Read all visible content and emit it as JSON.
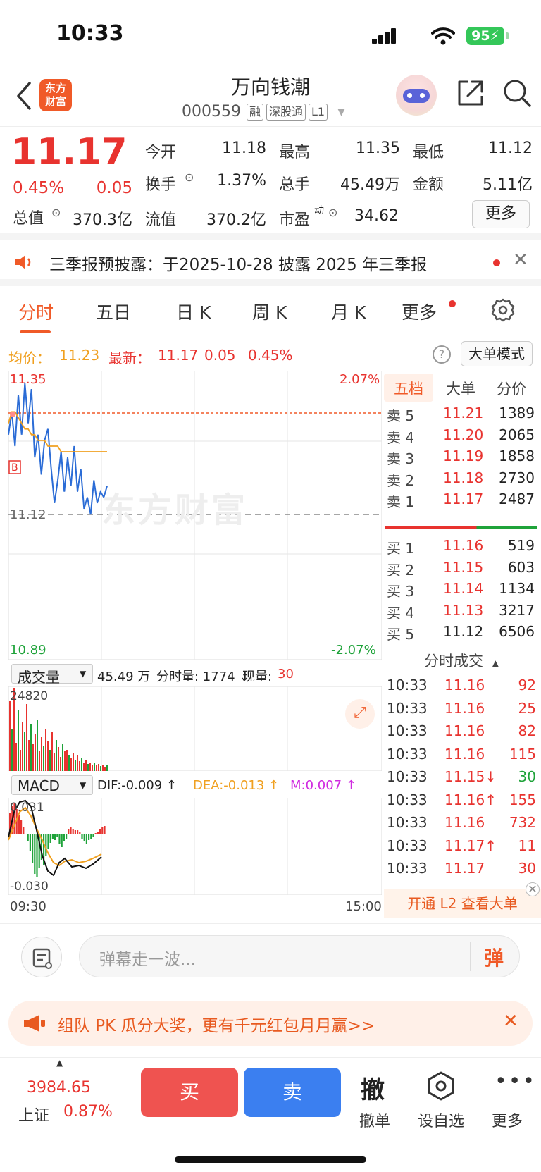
{
  "status_bar": {
    "time": "10:33",
    "battery": "95"
  },
  "header": {
    "logo_line1": "东方",
    "logo_line2": "财富",
    "stock_name": "万向钱潮",
    "stock_code": "000559",
    "tags": [
      "融",
      "深股通",
      "L1"
    ]
  },
  "quote": {
    "last_price": "11.17",
    "change_pct": "0.45%",
    "change_amt": "0.05",
    "open_label": "今开",
    "open": "11.18",
    "high_label": "最高",
    "high": "11.35",
    "low_label": "最低",
    "low": "11.12",
    "turnover_label": "换手",
    "turnover": "1.37%",
    "volume_label": "总手",
    "volume": "45.49万",
    "amount_label": "金额",
    "amount": "5.11亿",
    "mktcap_label": "总值",
    "mktcap": "370.3亿",
    "float_label": "流值",
    "float_cap": "370.2亿",
    "pe_label": "市盈",
    "pe_sup": "动",
    "pe": "34.62",
    "more_label": "更多"
  },
  "notice": {
    "text": "三季报预披露：于2025-10-28 披露 2025 年三季报"
  },
  "tabs": [
    "分时",
    "五日",
    "日 K",
    "周 K",
    "月 K",
    "更多"
  ],
  "price_info": {
    "avg_label": "均价：",
    "avg": "11.23",
    "latest_label": "最新：",
    "latest": "11.17",
    "chg": "0.05",
    "pct": "0.45%",
    "big_order_mode": "大单模式"
  },
  "chart": {
    "top_price": "11.35",
    "mid_price": "11.12",
    "bottom_price": "10.89",
    "top_pct": "2.07%",
    "bottom_pct": "-2.07%",
    "watermark": "东方财富",
    "volume_selector": "成交量",
    "volume_total": "45.49 万",
    "tick_volume_label": "分时量: 1774 ↓",
    "current_volume_label": "现量:",
    "current_volume": "30",
    "volume_max": "24820",
    "macd_selector": "MACD",
    "dif": "DIF:-0.009 ↑",
    "dea": "DEA:-0.013 ↑",
    "m": "M:0.007 ↑",
    "macd_top": "0.031",
    "macd_bottom": "-0.030",
    "time_start": "09:30",
    "time_end": "15:00"
  },
  "chart_data": {
    "type": "line",
    "title": "",
    "xlabel": "",
    "ylabel": "",
    "ylim": [
      10.89,
      11.35
    ],
    "reference_price": 11.12,
    "series": [
      {
        "values": [
          11.26,
          11.3,
          11.24,
          11.33,
          11.26,
          11.35,
          11.28,
          11.34,
          11.22,
          11.26,
          11.19,
          11.25,
          11.27,
          11.2,
          11.14,
          11.18,
          11.23,
          11.16,
          11.22,
          11.17,
          11.24,
          11.16,
          11.2,
          11.13,
          11.15,
          11.12,
          11.18,
          11.14,
          11.16,
          11.15,
          11.17
        ]
      },
      {
        "values": [
          11.28,
          11.3,
          11.3,
          11.29,
          11.28,
          11.27,
          11.27,
          11.26,
          11.26,
          11.25,
          11.25,
          11.25,
          11.24,
          11.24,
          11.24,
          11.24,
          11.23,
          11.23,
          11.23,
          11.23,
          11.23,
          11.23,
          11.23,
          11.23,
          11.23,
          11.23,
          11.23,
          11.23,
          11.23,
          11.23,
          11.23
        ]
      }
    ]
  },
  "order_book": {
    "tabs": [
      "五档",
      "大单",
      "分价"
    ],
    "asks": [
      {
        "label": "卖 5",
        "price": "11.21",
        "qty": "1389"
      },
      {
        "label": "卖 4",
        "price": "11.20",
        "qty": "2065"
      },
      {
        "label": "卖 3",
        "price": "11.19",
        "qty": "1858"
      },
      {
        "label": "卖 2",
        "price": "11.18",
        "qty": "2730"
      },
      {
        "label": "卖 1",
        "price": "11.17",
        "qty": "2487"
      }
    ],
    "bids": [
      {
        "label": "买 1",
        "price": "11.16",
        "qty": "519"
      },
      {
        "label": "买 2",
        "price": "11.15",
        "qty": "603"
      },
      {
        "label": "买 3",
        "price": "11.14",
        "qty": "1134"
      },
      {
        "label": "买 4",
        "price": "11.13",
        "qty": "3217"
      },
      {
        "label": "买 5",
        "price": "11.12",
        "qty": "6506"
      }
    ]
  },
  "ticks": {
    "title": "分时成交",
    "rows": [
      {
        "time": "10:33",
        "price": "11.16",
        "vol": "92",
        "color": "red",
        "vcolor": "red"
      },
      {
        "time": "10:33",
        "price": "11.16",
        "vol": "25",
        "color": "red",
        "vcolor": "red"
      },
      {
        "time": "10:33",
        "price": "11.16",
        "vol": "82",
        "color": "red",
        "vcolor": "red"
      },
      {
        "time": "10:33",
        "price": "11.16",
        "vol": "115",
        "color": "red",
        "vcolor": "red"
      },
      {
        "time": "10:33",
        "price": "11.15↓",
        "vol": "30",
        "color": "red",
        "vcolor": "green"
      },
      {
        "time": "10:33",
        "price": "11.16↑",
        "vol": "155",
        "color": "red",
        "vcolor": "red"
      },
      {
        "time": "10:33",
        "price": "11.16",
        "vol": "732",
        "color": "red",
        "vcolor": "red"
      },
      {
        "time": "10:33",
        "price": "11.17↑",
        "vol": "11",
        "color": "red",
        "vcolor": "red"
      },
      {
        "time": "10:33",
        "price": "11.17",
        "vol": "30",
        "color": "red",
        "vcolor": "red"
      }
    ],
    "l2_banner": "开通 L2 查看大单"
  },
  "comment": {
    "placeholder": "弹幕走一波...",
    "danmu_label": "弹"
  },
  "promo": {
    "text": "组队 PK 瓜分大奖，更有千元红包月月赢>>"
  },
  "bottom": {
    "index_value": "3984.65",
    "index_name": "上证",
    "index_pct": "0.87%",
    "buy": "买",
    "sell": "卖",
    "cancel_glyph": "撤",
    "cancel": "撤单",
    "watchlist": "设自选",
    "more": "更多"
  },
  "colors": {
    "up": "#e8332f",
    "down": "#1fa33a",
    "accent": "#f05a28",
    "buy": "#ef5350",
    "sell": "#3b7ff0"
  }
}
